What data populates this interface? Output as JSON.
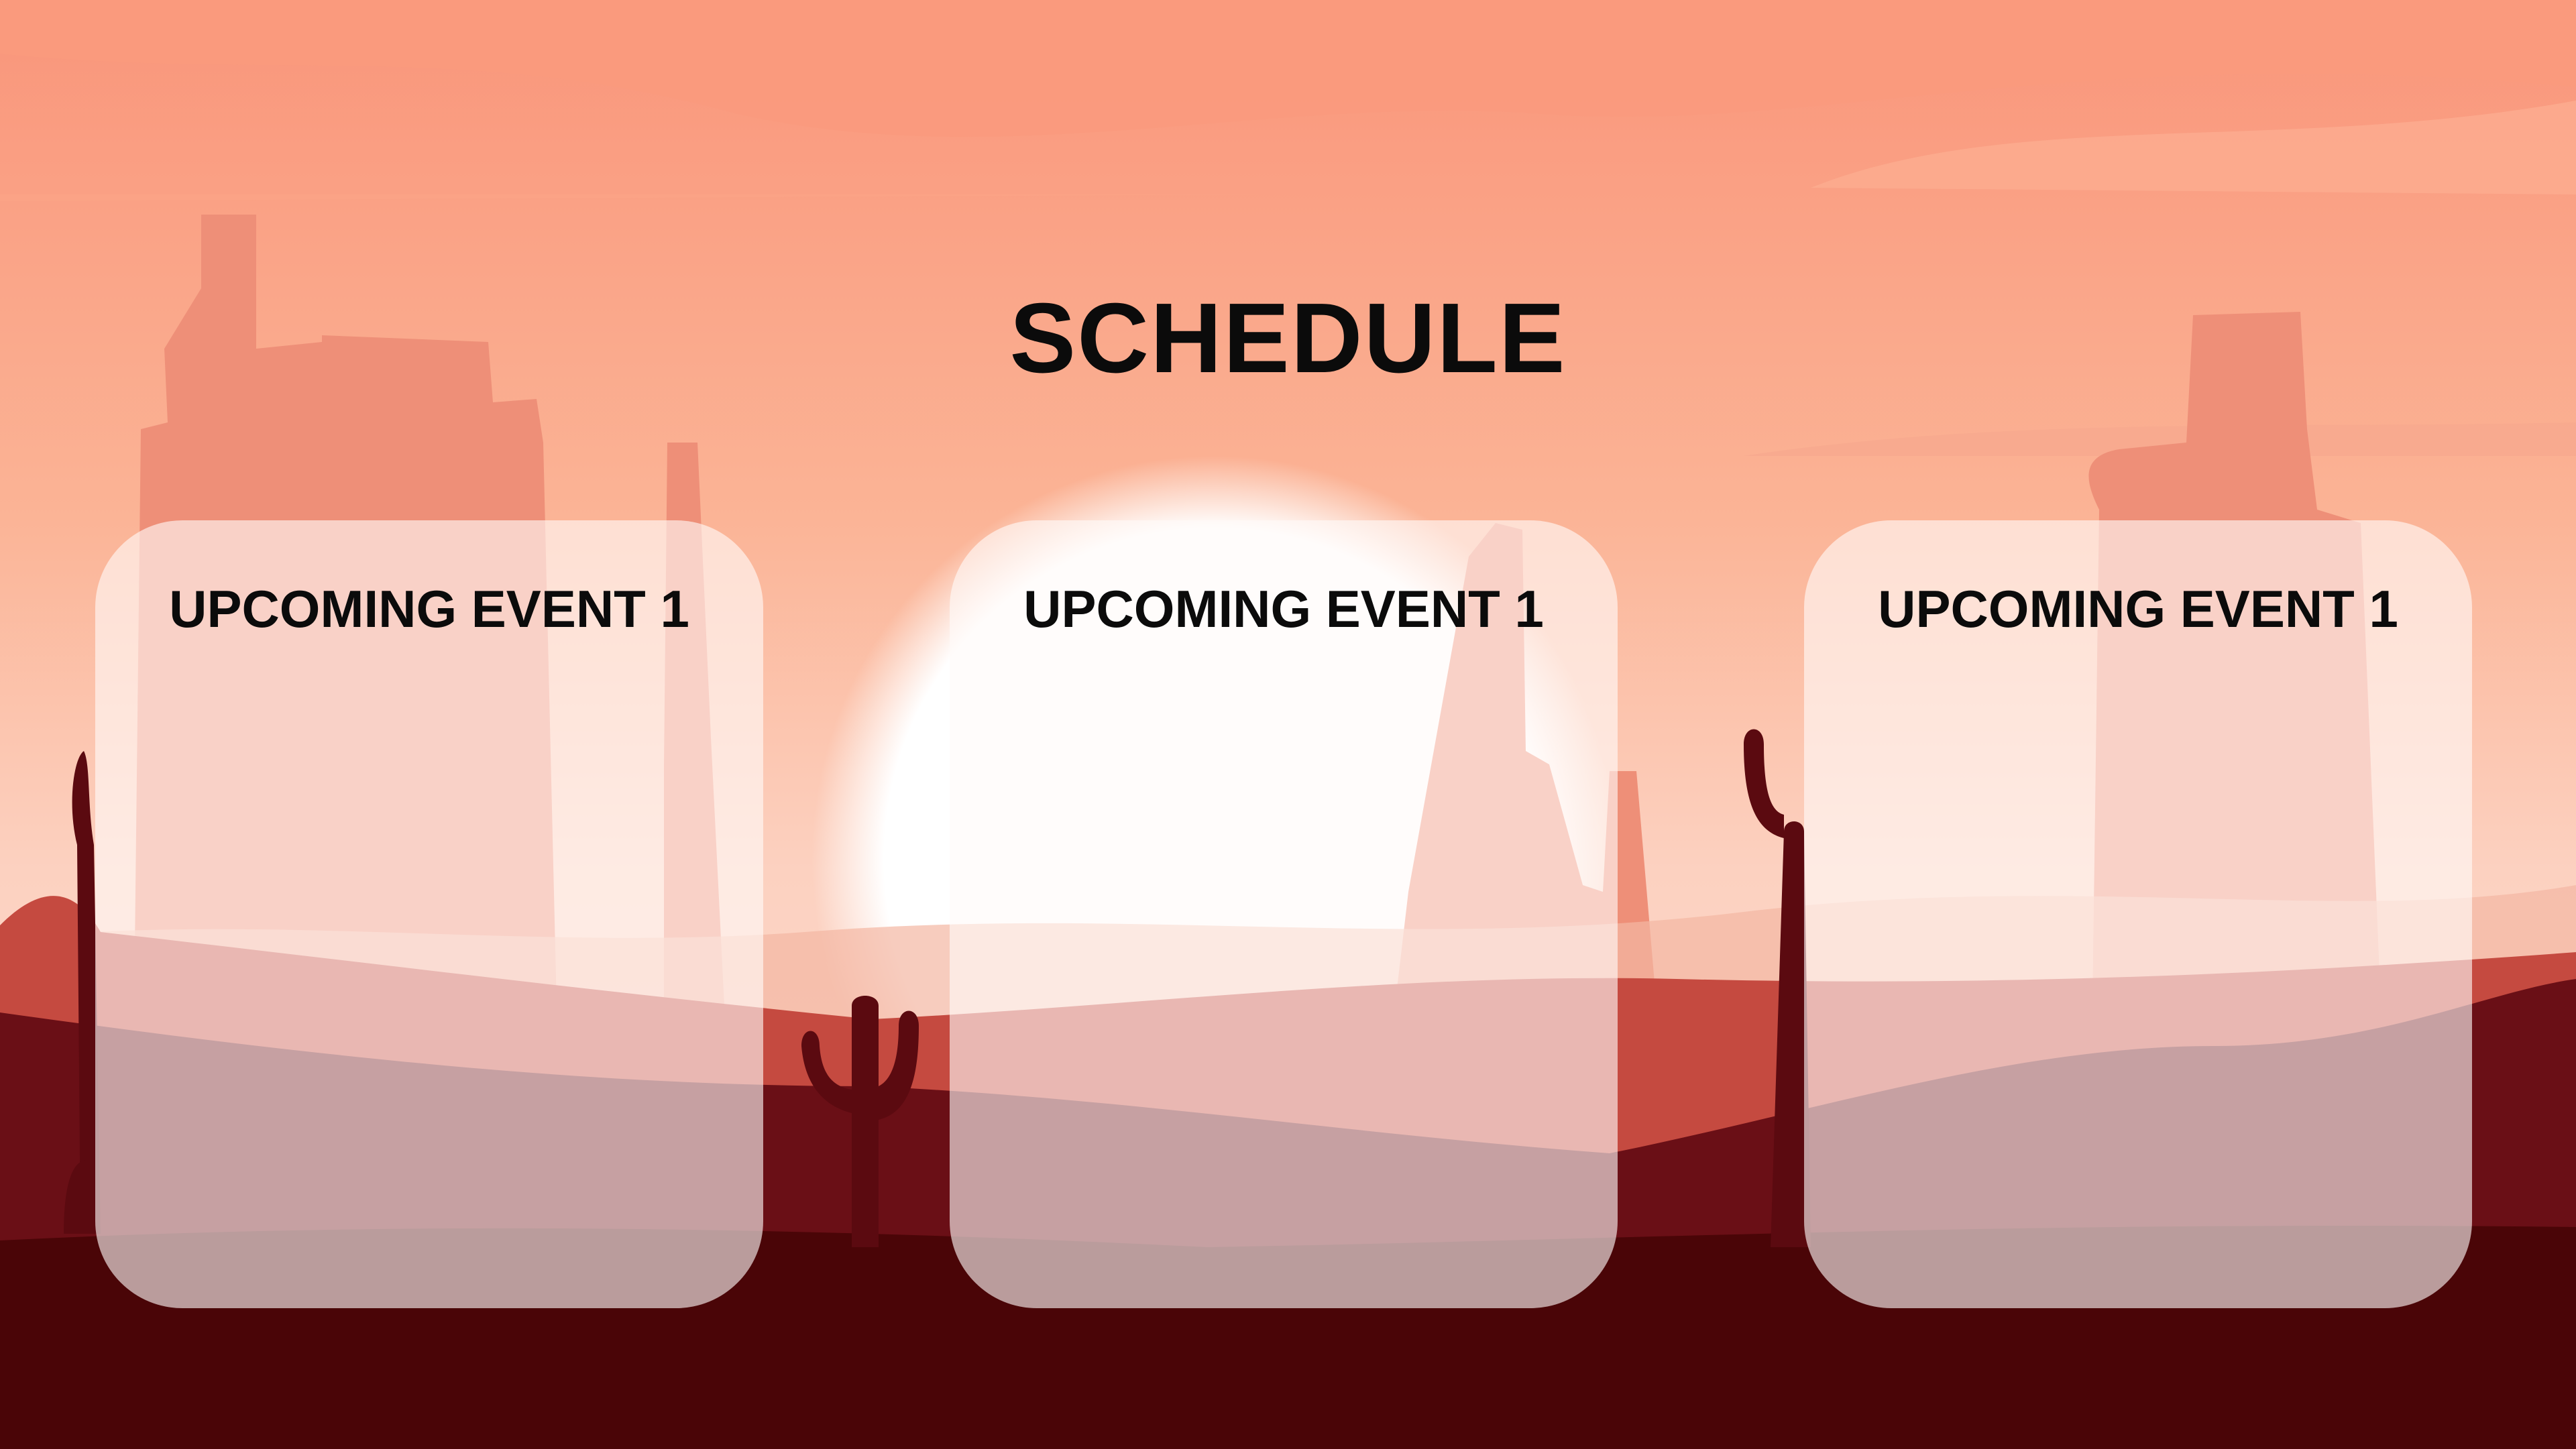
{
  "slide": {
    "title": "SCHEDULE",
    "cards": [
      {
        "heading": "UPCOMING EVENT 1"
      },
      {
        "heading": "UPCOMING EVENT 1"
      },
      {
        "heading": "UPCOMING EVENT 1"
      }
    ]
  },
  "icons": [
    "desert-landscape-background",
    "sun-icon",
    "cactus-icon",
    "mesa-rock-icon"
  ],
  "colors": {
    "sky_top": "#f9957a",
    "sky_bottom": "#fbd6c8",
    "sun": "#ffffff",
    "mesa": "#ee8f78",
    "dune_mid": "#c54a40",
    "dune_dark": "#6a0f16",
    "ground": "#4a0507",
    "card_fill": "#fffaf8",
    "text": "#0b0b0b"
  }
}
